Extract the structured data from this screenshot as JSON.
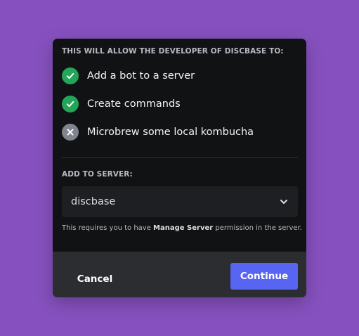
{
  "colors": {
    "background": "#8651bf",
    "modal": "#111214",
    "footer": "#2b2d31",
    "allowed": "#23a55a",
    "denied": "#80848e",
    "primary_button": "#5865f2",
    "select_bg": "#1e1f22"
  },
  "permissions": {
    "title": "THIS WILL ALLOW THE DEVELOPER OF DISCBASE TO:",
    "items": [
      {
        "label": "Add a bot to a server",
        "status": "allowed",
        "icon": "check-icon"
      },
      {
        "label": "Create commands",
        "status": "allowed",
        "icon": "check-icon"
      },
      {
        "label": "Microbrew some local kombucha",
        "status": "denied",
        "icon": "x-icon"
      }
    ]
  },
  "server": {
    "title": "ADD TO SERVER:",
    "selected": "discbase",
    "note_prefix": "This requires you to have ",
    "note_bold": "Manage Server",
    "note_suffix": " permission in the server."
  },
  "footer": {
    "cancel_label": "Cancel",
    "continue_label": "Continue"
  }
}
